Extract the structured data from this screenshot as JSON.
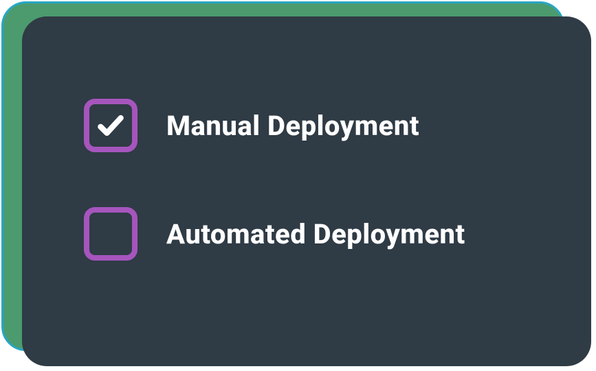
{
  "options": [
    {
      "label": "Manual Deployment",
      "checked": true
    },
    {
      "label": "Automated Deployment",
      "checked": false
    }
  ],
  "colors": {
    "card_bg": "#2f3b45",
    "checkbox_border": "#a655bd",
    "backdrop_border": "#27a6c5",
    "backdrop_fill": "#4b9b6e",
    "text": "#ffffff"
  }
}
